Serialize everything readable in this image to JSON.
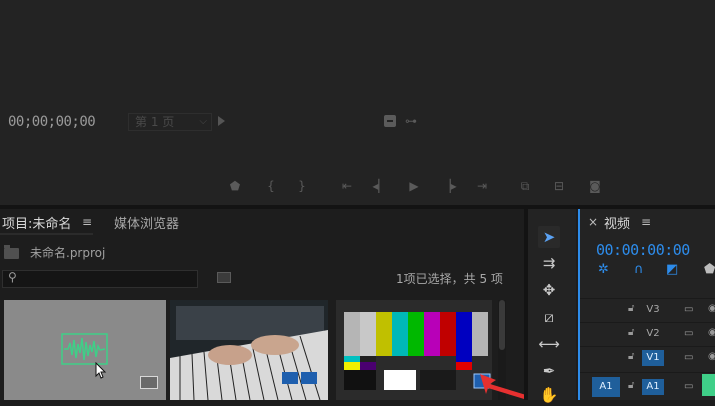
{
  "monitor": {
    "timecode": "00;00;00;00",
    "page_select": "第 1 页",
    "controls": [
      "marker-icon",
      "mark-in-icon",
      "mark-out-icon",
      "go-to-in-icon",
      "step-back-icon",
      "play-icon",
      "step-forward-icon",
      "go-to-out-icon",
      "insert-icon",
      "overwrite-icon",
      "export-frame-icon"
    ]
  },
  "project_panel": {
    "tab_project": "项目:未命名",
    "tab_media": "媒体浏览器",
    "project_file": "未命名.prproj",
    "search_placeholder": "",
    "selection_status": "1项已选择，共 5 项",
    "thumbnails": [
      "audio-clip",
      "piano-video",
      "color-bars"
    ]
  },
  "tools": [
    "selection-tool",
    "track-select-tool",
    "ripple-edit-tool",
    "razor-tool",
    "slip-tool",
    "pen-tool",
    "hand-tool"
  ],
  "timeline": {
    "title": "视频",
    "timecode": "00:00:00:00",
    "tracks": [
      {
        "name": "V3",
        "active": false
      },
      {
        "name": "V2",
        "active": false
      },
      {
        "name": "V1",
        "active": true
      },
      {
        "name": "A1",
        "active": true
      }
    ],
    "source_patch": "A1"
  },
  "colors": {
    "accent": "#2d8ceb",
    "arrow": "#e63030",
    "audio_wave": "#3fcf88"
  }
}
